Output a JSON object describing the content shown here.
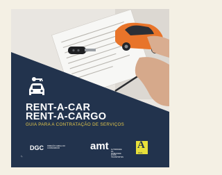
{
  "cover": {
    "title_line1": "RENT-A-CAR",
    "title_line2": "RENT-A-CARGO",
    "subtitle": "GUIA PARA A CONTRATAÇÃO DE SERVIÇOS",
    "colors": {
      "navy": "#22334d",
      "gold": "#e6c94a",
      "car_orange": "#e8742a",
      "background": "#f4f0e4"
    },
    "icons": [
      "car-key-icon",
      "car-icon"
    ]
  },
  "logos": {
    "dgc": {
      "name": "DGC",
      "descriptor": "DIREÇÃO-GERAL DO CONSUMIDOR"
    },
    "amt": {
      "name": "amt",
      "descriptor": "AUTORIDADE DA MOBILIDADE E DOS TRANSPORTES"
    },
    "raal": {
      "name": "RAAL"
    }
  }
}
